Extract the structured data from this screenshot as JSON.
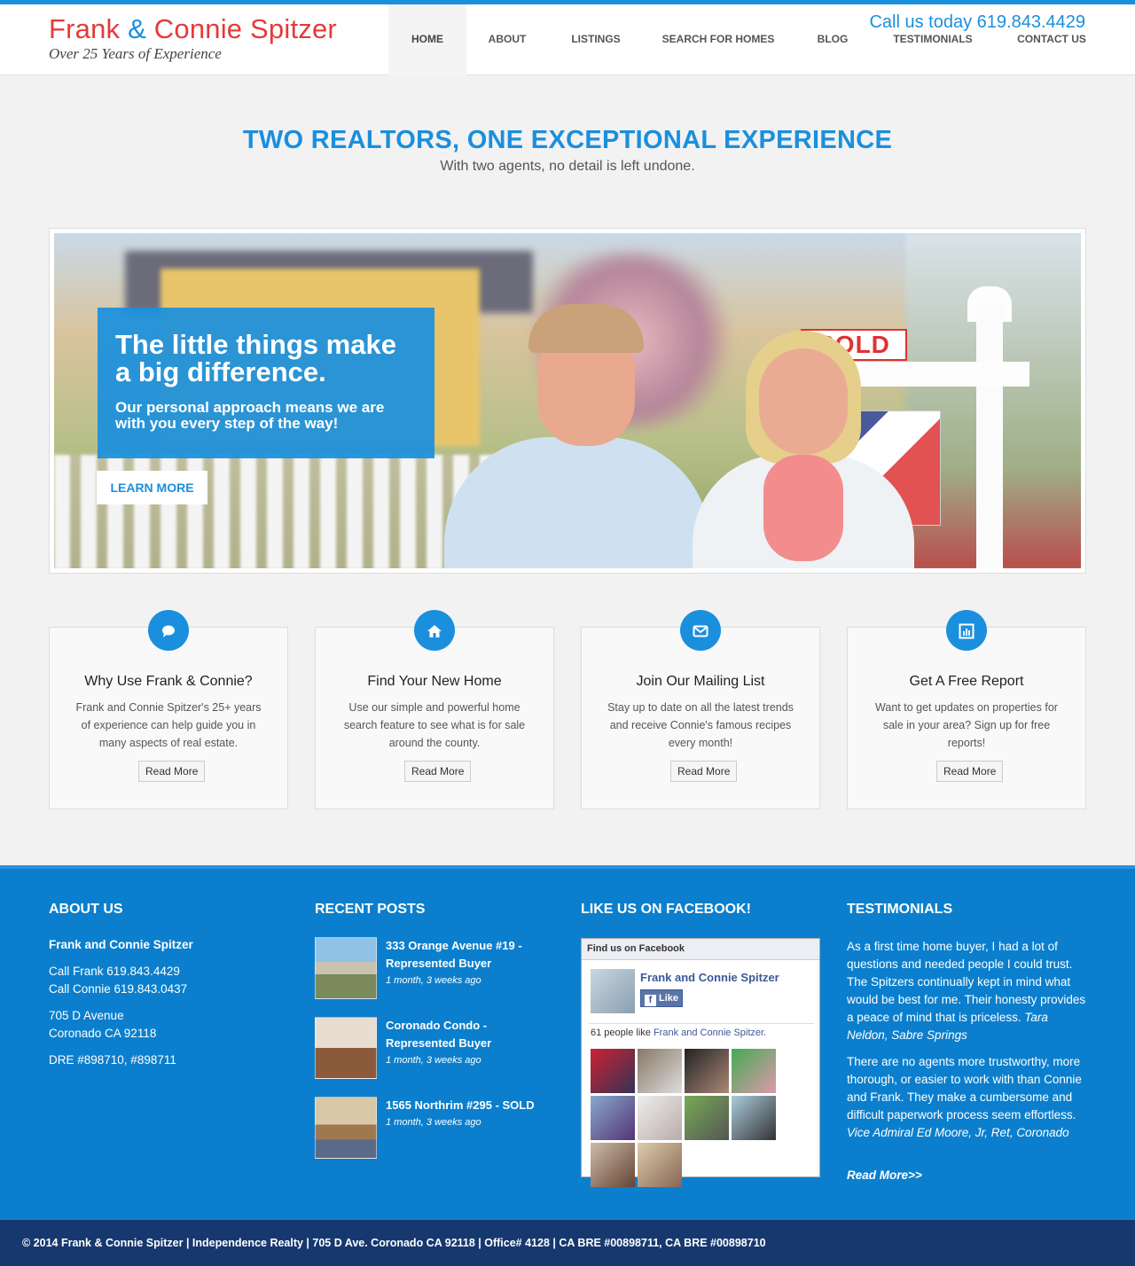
{
  "header": {
    "logo_first": "Frank",
    "logo_amp": "&",
    "logo_last": "Connie Spitzer",
    "tagline": "Over 25 Years of Experience",
    "call_us": "Call us today 619.843.4429",
    "nav": [
      {
        "label": "HOME",
        "active": true
      },
      {
        "label": "ABOUT"
      },
      {
        "label": "LISTINGS"
      },
      {
        "label": "SEARCH FOR HOMES"
      },
      {
        "label": "BLOG"
      },
      {
        "label": "TESTIMONIALS"
      },
      {
        "label": "CONTACT US"
      }
    ]
  },
  "hero": {
    "title": "TWO REALTORS, ONE EXCEPTIONAL EXPERIENCE",
    "subtitle": "With two agents, no detail is left undone."
  },
  "slider": {
    "headline": "The little things make a big difference.",
    "text": "Our personal approach means we are with you every step of the way!",
    "button": "LEARN MORE",
    "sign_sold": "SOLD"
  },
  "features": [
    {
      "icon": "speech-bubble-icon",
      "title": "Why Use Frank & Connie?",
      "text": "Frank and Connie Spitzer's 25+ years of experience can help guide you in many aspects of real estate.",
      "button": "Read More"
    },
    {
      "icon": "home-icon",
      "title": "Find Your New Home",
      "text": "Use our simple and powerful home search feature to see what is for sale around the county.",
      "button": "Read More"
    },
    {
      "icon": "envelope-icon",
      "title": "Join Our Mailing List",
      "text": "Stay up to date on all the latest trends and receive Connie's famous recipes every month!",
      "button": "Read More"
    },
    {
      "icon": "report-chart-icon",
      "title": "Get A Free Report",
      "text": "Want to get updates on properties for sale in your area? Sign up for free reports!",
      "button": "Read More"
    }
  ],
  "footer": {
    "about": {
      "title": "ABOUT US",
      "name": "Frank and Connie Spitzer",
      "call_frank": "Call Frank 619.843.4429",
      "call_connie": "Call Connie 619.843.0437",
      "address1": "705 D Avenue",
      "address2": "Coronado CA 92118",
      "dre": "DRE #898710, #898711"
    },
    "recent_posts": {
      "title": "RECENT POSTS",
      "posts": [
        {
          "title": "333 Orange Avenue #19 - Represented Buyer",
          "date": "1 month, 3 weeks ago"
        },
        {
          "title": "Coronado Condo - Represented Buyer",
          "date": "1 month, 3 weeks ago"
        },
        {
          "title": "1565 Northrim #295 - SOLD",
          "date": "1 month, 3 weeks ago"
        }
      ]
    },
    "facebook": {
      "title": "LIKE US ON FACEBOOK!",
      "box_header": "Find us on Facebook",
      "page_name": "Frank and Connie Spitzer",
      "like_label": "Like",
      "count_prefix": "61 people like ",
      "count_link": "Frank and Connie Spitzer",
      "count_suffix": "."
    },
    "testimonials": {
      "title": "TESTIMONIALS",
      "items": [
        {
          "text": "As a first time home buyer, I had a lot of questions and needed people I could trust. The Spitzers continually kept in mind what would be best for me. Their honesty provides a peace of mind that is priceless. ",
          "who": "Tara Neldon, Sabre Springs"
        },
        {
          "text": "There are no agents more trustworthy, more thorough, or easier to work with than Connie and Frank. They make a cumbersome and difficult paperwork process seem effortless. ",
          "who": "Vice Admiral Ed Moore, Jr, Ret, Coronado"
        }
      ],
      "read_more": "Read More>>"
    },
    "bottom": "© 2014 Frank & Connie Spitzer | Independence Realty | 705 D Ave. Coronado CA 92118 | Office# 4128 | CA BRE #00898711, CA BRE #00898710"
  },
  "colors": {
    "accent": "#1a8fdd",
    "logo_red": "#e53a3a",
    "footer_blue": "#0b7fcd",
    "bottom_navy": "#17386f"
  }
}
